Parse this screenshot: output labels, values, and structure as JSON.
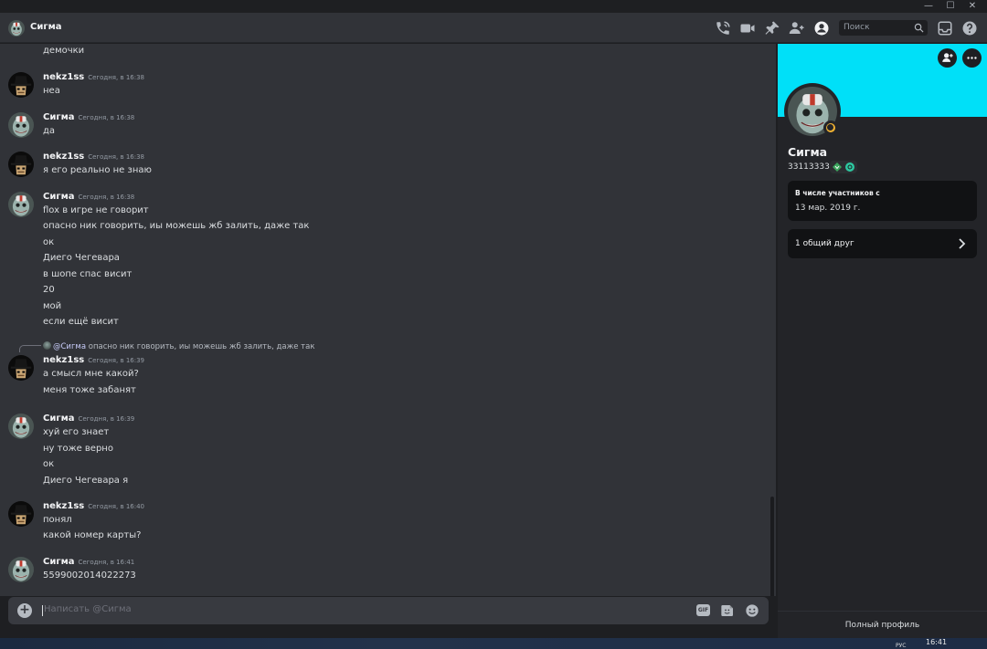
{
  "window": {
    "minimize": "—",
    "maximize": "☐",
    "close": "✕"
  },
  "header": {
    "name": "Сигма",
    "search_placeholder": "Поиск",
    "icons": [
      "phone-call-icon",
      "video-call-icon",
      "pin-icon",
      "add-friend-icon",
      "user-profile-icon",
      "search-icon",
      "inbox-icon",
      "help-icon"
    ]
  },
  "messages": [
    {
      "continuation": true,
      "lines": [
        "демочки"
      ]
    },
    {
      "author": "nekz1ss",
      "time": "Сегодня, в 16:38",
      "avatar": "black-hat-avatar",
      "lines": [
        "неа"
      ]
    },
    {
      "author": "Сигма",
      "time": "Сегодня, в 16:38",
      "avatar": "clown-avatar",
      "lines": [
        "да"
      ]
    },
    {
      "author": "nekz1ss",
      "time": "Сегодня, в 16:38",
      "avatar": "black-hat-avatar",
      "lines": [
        "я его реально не знаю"
      ]
    },
    {
      "author": "Сигма",
      "time": "Сегодня, в 16:38",
      "avatar": "clown-avatar",
      "lines": [
        "flox в игре не говорит",
        "опасно ник говорить, иы можешь жб залить, даже так",
        "ок",
        "Диего Чегевара",
        "в шопе спас висит",
        "20",
        "мой",
        "если ещё висит"
      ]
    },
    {
      "author": "nekz1ss",
      "time": "Сегодня, в 16:39",
      "avatar": "black-hat-avatar",
      "reply": {
        "mention": "@Сигма",
        "text": "опасно ник говорить, иы можешь жб залить, даже так"
      },
      "lines": [
        "а смысл мне какой?",
        "меня тоже забанят"
      ]
    },
    {
      "author": "Сигма",
      "time": "Сегодня, в 16:39",
      "avatar": "clown-avatar",
      "lines": [
        "хуй его знает",
        "ну тоже верно",
        "ок",
        "Диего Чегевара я"
      ]
    },
    {
      "author": "nekz1ss",
      "time": "Сегодня, в 16:40",
      "avatar": "black-hat-avatar",
      "lines": [
        "понял",
        "какой номер карты?"
      ]
    },
    {
      "author": "Сигма",
      "time": "Сегодня, в 16:41",
      "avatar": "clown-avatar",
      "lines": [
        "5599002014022273"
      ]
    }
  ],
  "composer": {
    "placeholder": "Написать @Сигма",
    "gif_label": "GIF",
    "icons": [
      "add-attachment-icon",
      "gif-icon",
      "sticker-icon",
      "emoji-icon"
    ]
  },
  "profile": {
    "name": "Сигма",
    "tag": "33113333",
    "banner_color": "#00e0f8",
    "status": "idle",
    "badges": [
      "hypesquad-badge",
      "nitro-badge"
    ],
    "member_since_title": "В числе участников с",
    "member_since_value": "13 мар. 2019 г.",
    "mutual_friends": "1 общий друг",
    "full_profile": "Полный профиль"
  },
  "taskbar": {
    "time": "16:41",
    "lang": "РУС"
  },
  "colors": {
    "background": "#313338",
    "sidebar": "#232428",
    "accent_banner": "#00e0f8",
    "idle": "#f0b232"
  }
}
